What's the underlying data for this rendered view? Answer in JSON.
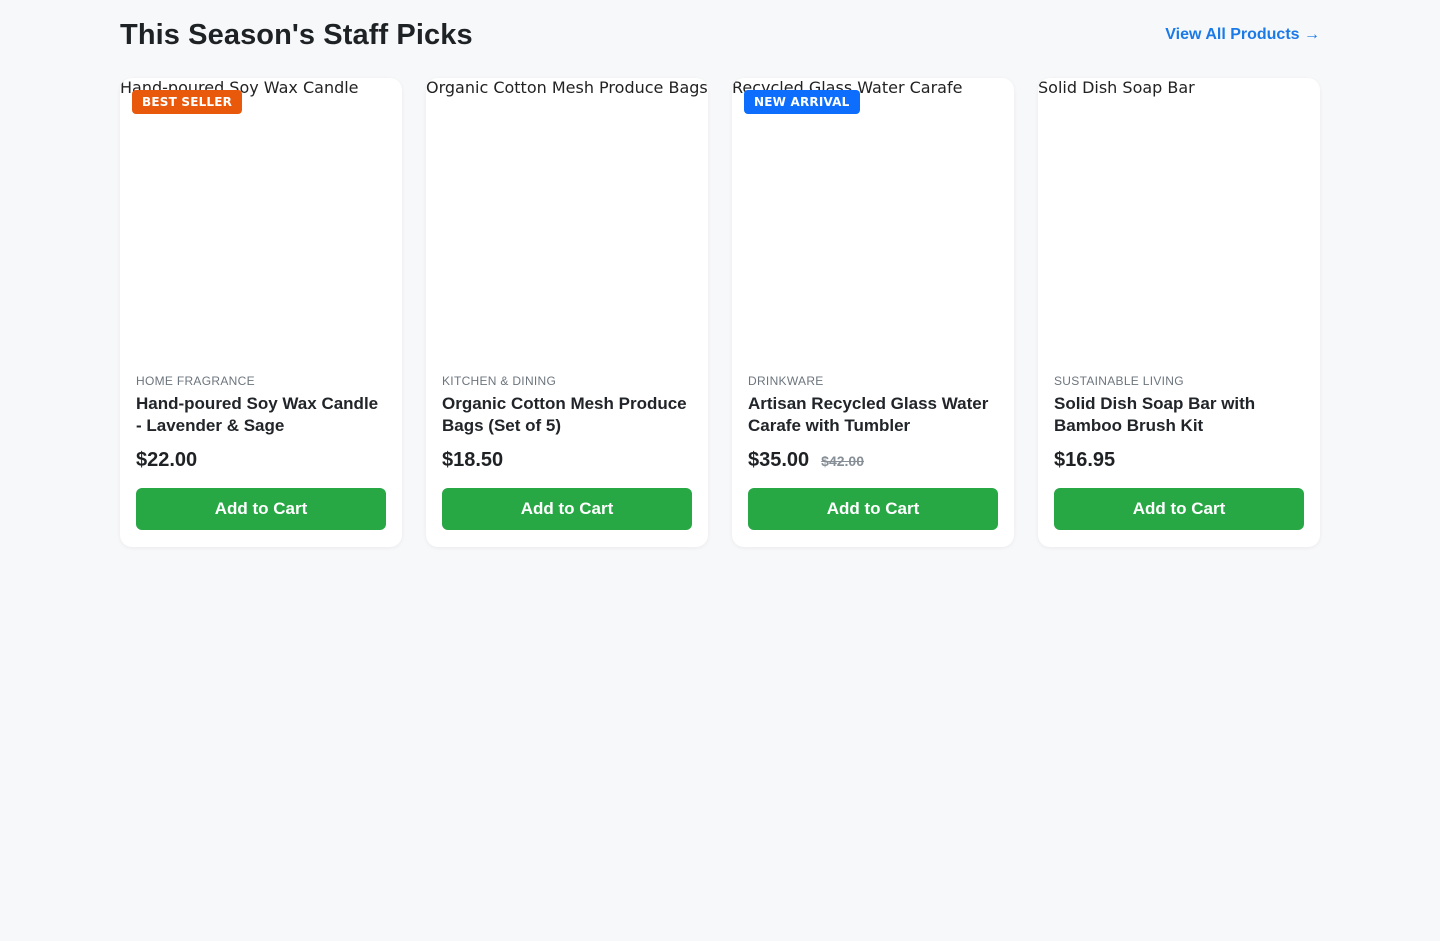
{
  "header": {
    "title": "This Season's Staff Picks",
    "view_all": "View All Products →"
  },
  "colors": {
    "badge_best_seller": "#e8590c",
    "badge_new_arrival": "#0d6efd",
    "add_to_cart": "#28a745",
    "link": "#1a7ae8"
  },
  "products": [
    {
      "image_alt": "Hand-poured Soy Wax Candle",
      "badge": "BEST SELLER",
      "category": "HOME FRAGRANCE",
      "name": "Hand-poured Soy Wax Candle - Lavender & Sage",
      "price": "$22.00",
      "button": "Add to Cart"
    },
    {
      "image_alt": "Organic Cotton Mesh Produce Bags",
      "category": "KITCHEN & DINING",
      "name": "Organic Cotton Mesh Produce Bags (Set of 5)",
      "price": "$18.50",
      "button": "Add to Cart"
    },
    {
      "image_alt": "Recycled Glass Water Carafe",
      "badge": "NEW ARRIVAL",
      "category": "DRINKWARE",
      "name": "Artisan Recycled Glass Water Carafe with Tumbler",
      "price": "$35.00",
      "old_price": "$42.00",
      "button": "Add to Cart"
    },
    {
      "image_alt": "Solid Dish Soap Bar",
      "category": "SUSTAINABLE LIVING",
      "name": "Solid Dish Soap Bar with Bamboo Brush Kit",
      "price": "$16.95",
      "button": "Add to Cart"
    }
  ]
}
